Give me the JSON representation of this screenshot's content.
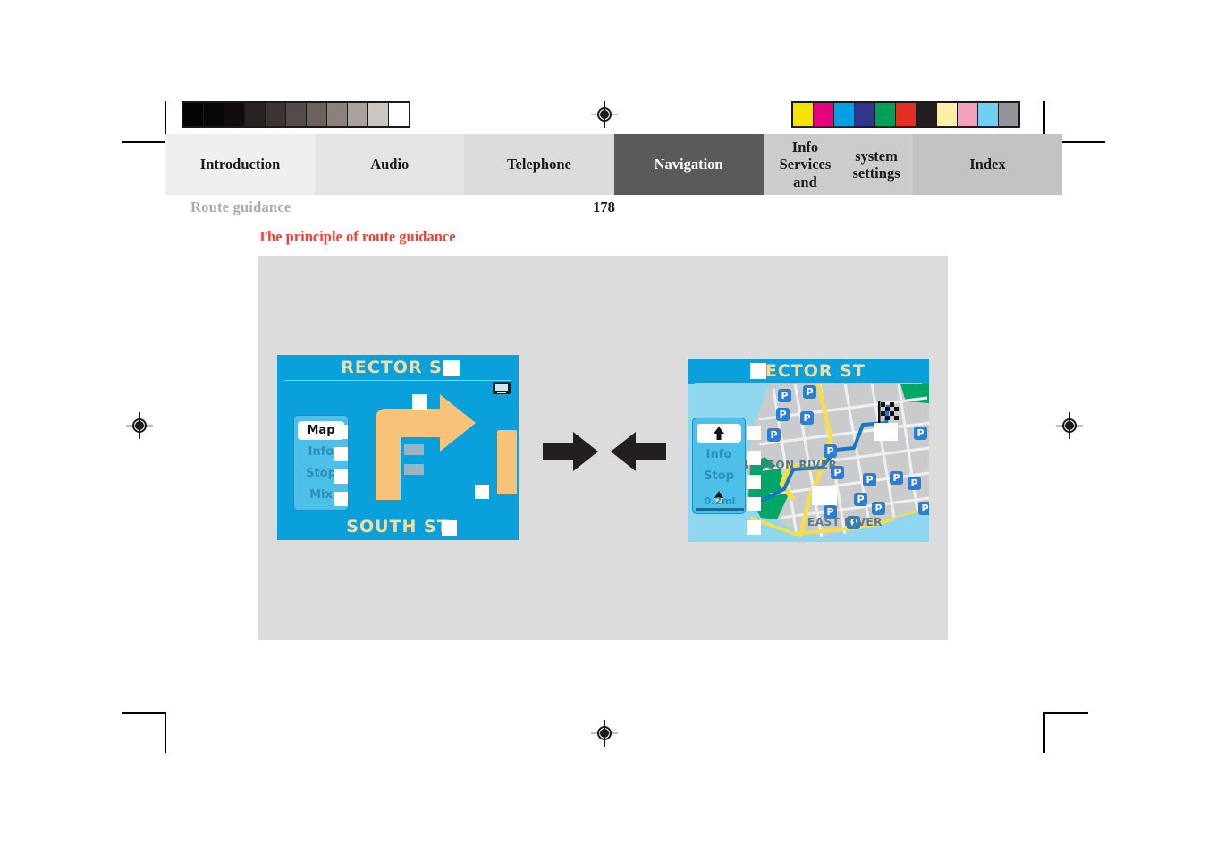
{
  "document": {
    "running_head": "Route guidance",
    "page_number": "178",
    "section_title": "The principle of route guidance"
  },
  "tabs": [
    {
      "label": "Introduction",
      "active": false,
      "bg": "#efefef"
    },
    {
      "label": "Audio",
      "active": false,
      "bg": "#e4e4e4"
    },
    {
      "label": "Telephone",
      "active": false,
      "bg": "#dcdcdc"
    },
    {
      "label": "Navigation",
      "active": true,
      "bg": "#5a5a5a"
    },
    {
      "label": "Info Services and\nsystem settings",
      "active": false,
      "bg": "#cccccc"
    },
    {
      "label": "Index",
      "active": false,
      "bg": "#c3c3c3"
    }
  ],
  "calibration": {
    "grayscale_label": "grayscale-calibration-strip",
    "grayscale": [
      "#040404",
      "#070505",
      "#140c0a",
      "#282320",
      "#3b3531",
      "#544c48",
      "#6b625e",
      "#8b827e",
      "#a9a19c",
      "#cbc6c2",
      "#ffffff"
    ],
    "color_label": "color-calibration-strip",
    "colors": [
      "#f5e400",
      "#e6007e",
      "#00a0e2",
      "#32358c",
      "#00a05a",
      "#e62d24",
      "#231f20",
      "#faefa6",
      "#f2a0be",
      "#6fd0f2",
      "#939598"
    ]
  },
  "screens": {
    "turn_view": {
      "name": "turn-by-turn-arrow-view",
      "title": "RECTOR ST",
      "bottom_label": "SOUTH ST",
      "menu": [
        {
          "label": "Map",
          "active": true
        },
        {
          "label": "Info",
          "active": false
        },
        {
          "label": "Stop",
          "active": false
        },
        {
          "label": "Mix",
          "active": false
        }
      ],
      "status_icon": "display-icon",
      "arrow_glyph": "turn-right-arrow",
      "bg_color": "#0aa0dc",
      "arrow_color": "#f8c278",
      "text_color": "#f3dca0"
    },
    "map_view": {
      "name": "map-overview-view",
      "title": "RECTOR ST",
      "menu": [
        {
          "label": "",
          "icon": "up-arrow-icon",
          "active": true
        },
        {
          "label": "Info",
          "active": false
        },
        {
          "label": "Stop",
          "active": false
        },
        {
          "label": "",
          "icon": "compass-icon",
          "active": false
        }
      ],
      "scale": "0.2mi",
      "map_labels": [
        "HUDSON RIVER",
        "EAST RIVER"
      ],
      "poi_icon": "P",
      "destination_icon": "checkered-flag-icon",
      "route_color": "#1878c8",
      "water_color": "#8fd6ef",
      "land_color": "#c9cbcc",
      "park_color": "#00a665"
    }
  },
  "transition": {
    "forward_arrow": "arrow-right",
    "back_arrow": "arrow-left",
    "arrow_color": "#231f20"
  }
}
